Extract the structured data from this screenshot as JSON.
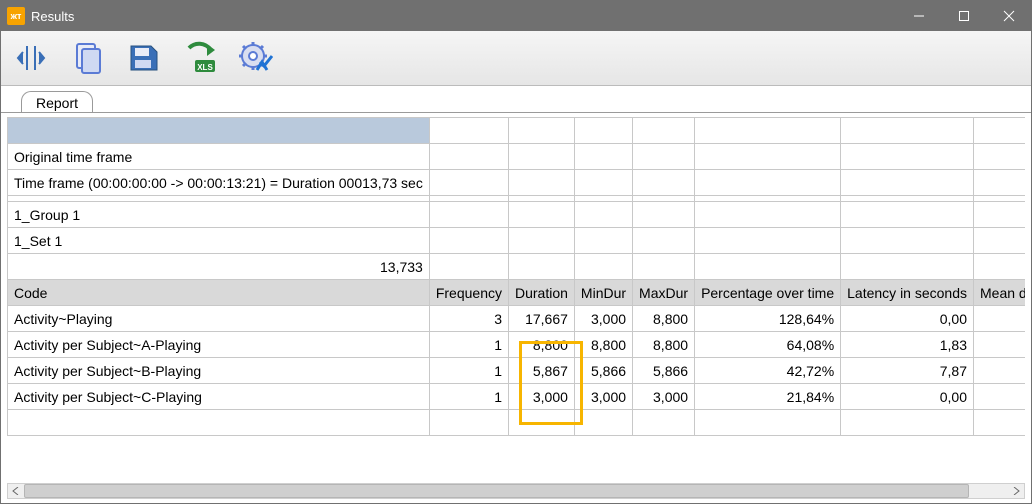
{
  "window": {
    "title": "Results"
  },
  "toolbar": {
    "btn1": "columns-icon",
    "btn2": "copy-icon",
    "btn3": "save-icon",
    "btn4": "export-excel-icon",
    "btn5": "settings-icon"
  },
  "tabs": {
    "report": "Report"
  },
  "rows": {
    "orig_tf": "Original time frame",
    "tf_line": "Time frame  (00:00:00:00 -> 00:00:13:21) = Duration 00013,73 sec",
    "group": "1_Group 1",
    "set": "1_Set 1",
    "total_dur": "13,733"
  },
  "headers": {
    "code": "Code",
    "freq": "Frequency",
    "dur": "Duration",
    "min": "MinDur",
    "max": "MaxDur",
    "pct": "Percentage over time",
    "lat": "Latency in seconds",
    "mean": "Mean du"
  },
  "data": [
    {
      "code": "Activity~Playing",
      "freq": "3",
      "dur": "17,667",
      "min": "3,000",
      "max": "8,800",
      "pct": "128,64%",
      "lat": "0,00"
    },
    {
      "code": "Activity per Subject~A-Playing",
      "freq": "1",
      "dur": "8,800",
      "min": "8,800",
      "max": "8,800",
      "pct": "64,08%",
      "lat": "1,83"
    },
    {
      "code": "Activity per Subject~B-Playing",
      "freq": "1",
      "dur": "5,867",
      "min": "5,866",
      "max": "5,866",
      "pct": "42,72%",
      "lat": "7,87"
    },
    {
      "code": "Activity per Subject~C-Playing",
      "freq": "1",
      "dur": "3,000",
      "min": "3,000",
      "max": "3,000",
      "pct": "21,84%",
      "lat": "0,00"
    }
  ]
}
